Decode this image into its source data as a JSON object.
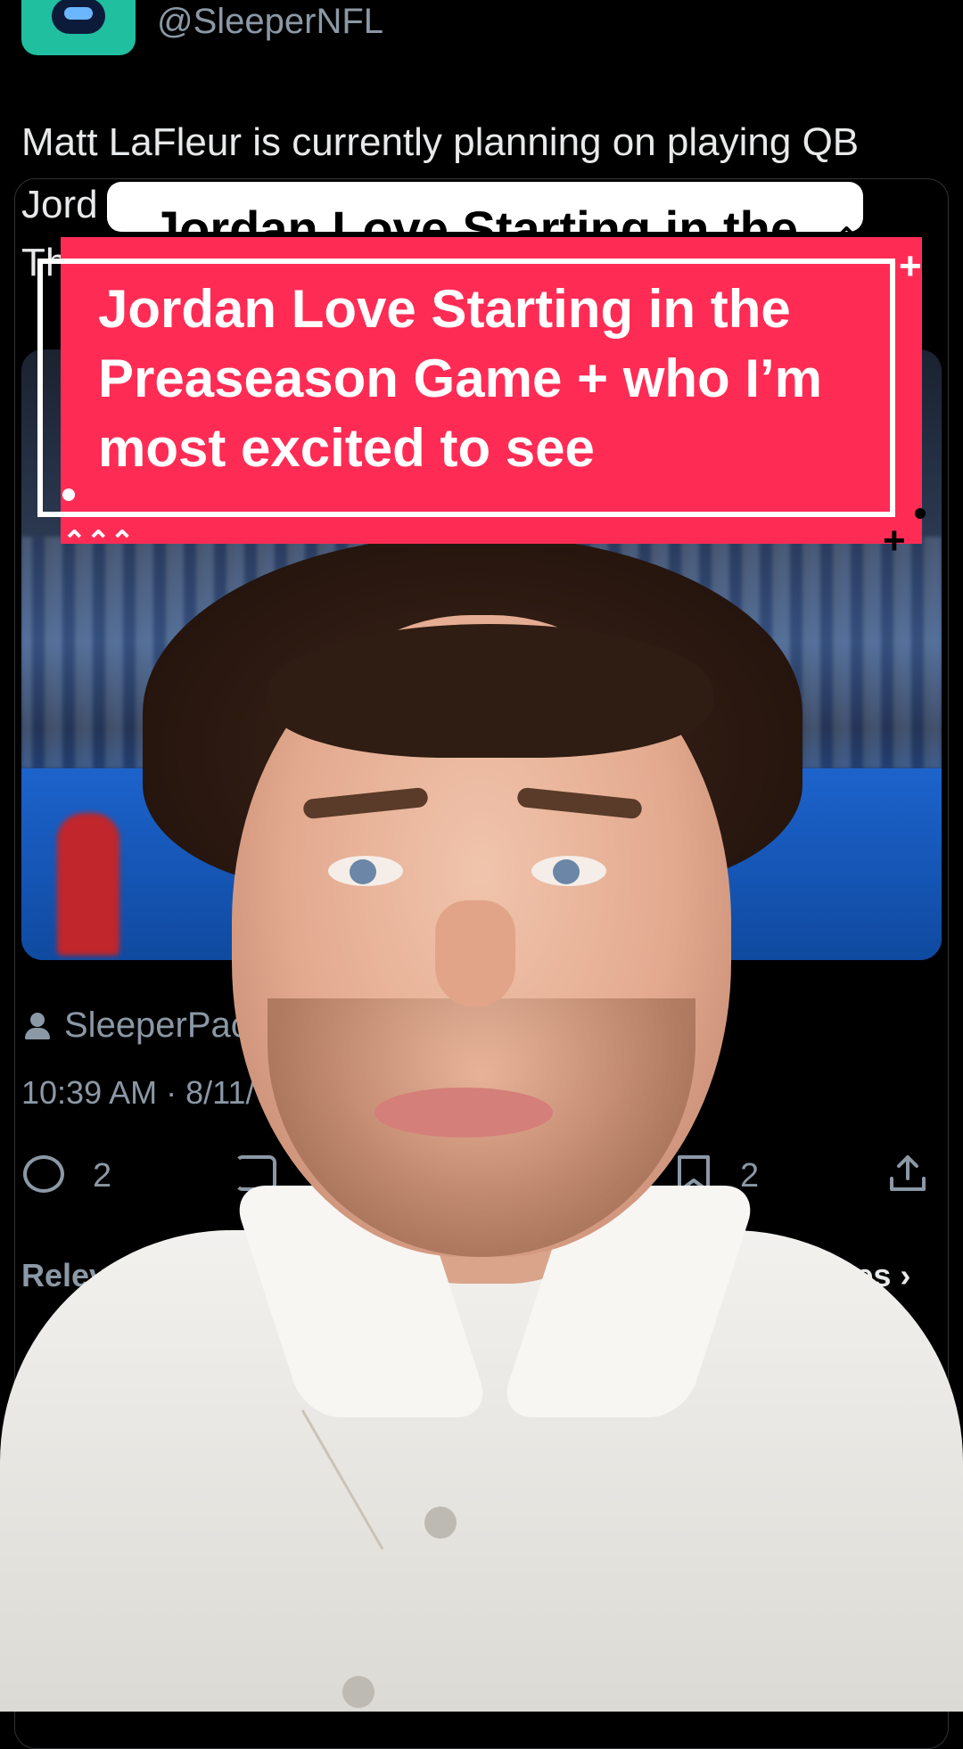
{
  "tweet": {
    "handle": "@SleeperNFL",
    "text_line1": "Matt LaFleur is currently planning on playing QB",
    "text_line2": "Jord",
    "text_line3": "Th",
    "author": "SleeperPac",
    "timestamp": "10:39 AM · 8/11/",
    "reply_count": "2",
    "bookmark_count": "2",
    "relevant_label": "Relevant",
    "view_quotes_label": "View quotes ›"
  },
  "overlay": {
    "strip_text": "Jordan Love Starting in the",
    "card_title": "Jordan Love Starting in the Preaseason Game + who I’m most excited to see"
  },
  "colors": {
    "card_red": "#fe2c55",
    "avatar_green": "#1fbf9f",
    "muted_text": "#8b98a5"
  }
}
